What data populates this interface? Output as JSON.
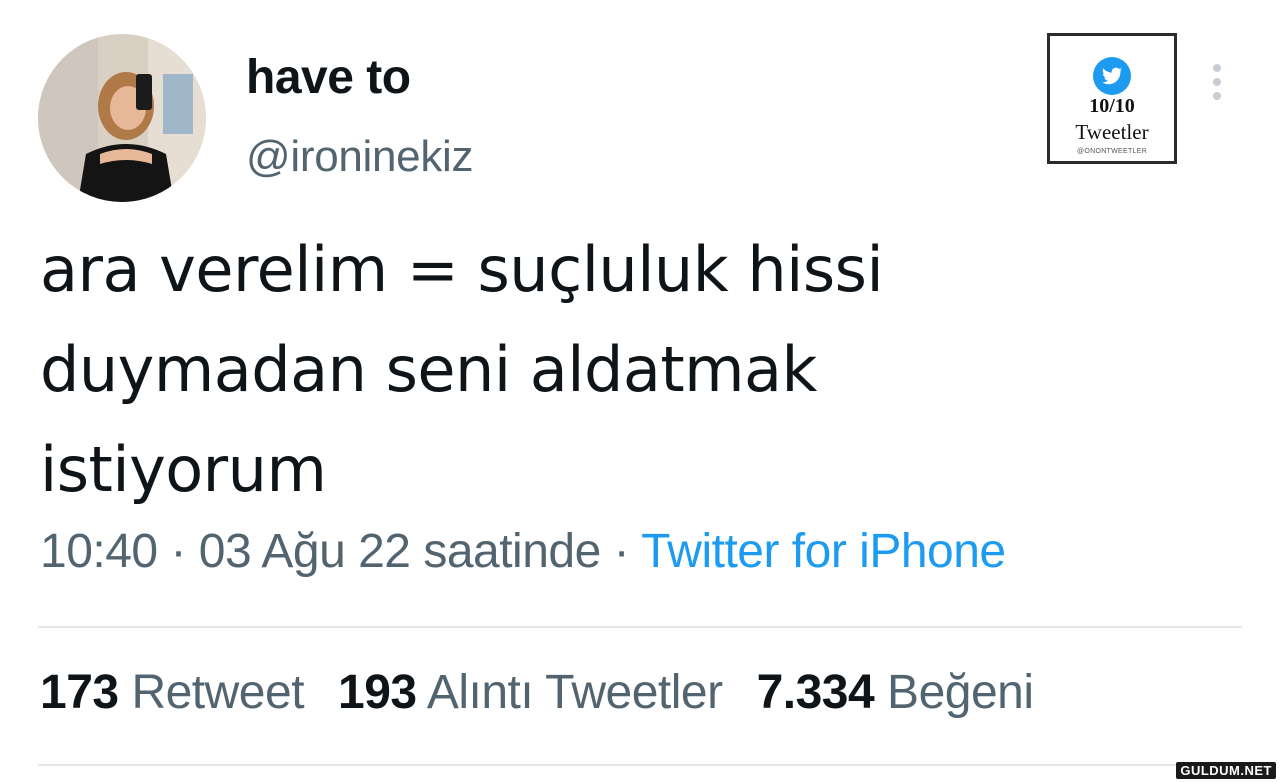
{
  "user": {
    "display_name": "have to",
    "handle": "@ironinekiz",
    "avatar_icon": "profile-photo"
  },
  "stamp": {
    "icon": "twitter-bird-icon",
    "count": "10/10",
    "label": "Tweetler",
    "credit": "@ONONTWEETLER"
  },
  "menu": {
    "icon": "more-vertical-icon"
  },
  "tweet": {
    "lines": [
      "ara verelim = suçluluk hissi",
      "duymadan seni aldatmak",
      "istiyorum"
    ],
    "time": "10:40",
    "date": "03 Ağu 22 saatinde",
    "separator": " · ",
    "source": "Twitter for iPhone"
  },
  "stats": {
    "retweets": {
      "num": "173",
      "label": "Retweet"
    },
    "quotes": {
      "num": "193",
      "label": "Alıntı Tweetler"
    },
    "likes": {
      "num": "7.334",
      "label": "Beğeni"
    }
  },
  "colors": {
    "primary_text": "#0f1419",
    "secondary_text": "#536471",
    "link": "#1d9bf0",
    "divider": "#e4e8eb"
  },
  "watermark": "GULDUM.NET"
}
